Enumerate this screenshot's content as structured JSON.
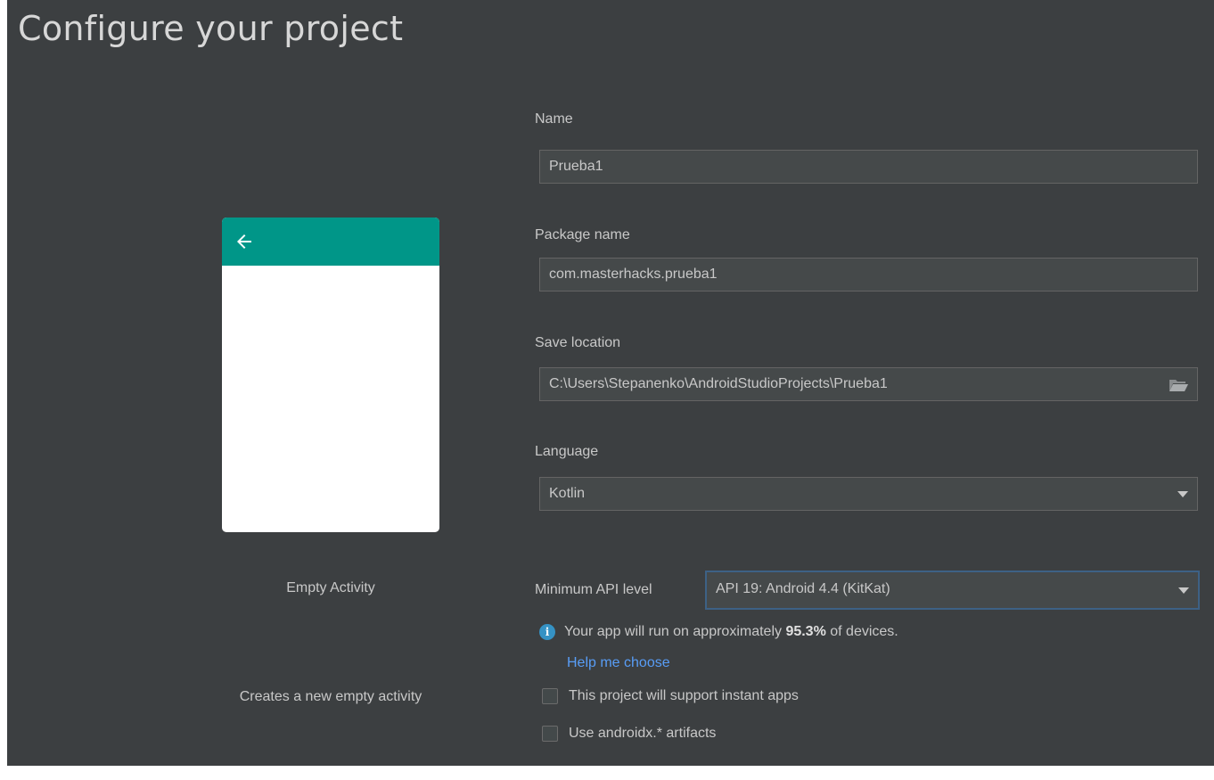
{
  "header": {
    "title": "Configure your project"
  },
  "template": {
    "name": "Empty Activity",
    "description": "Creates a new empty activity",
    "colors": {
      "app_bar": "#009688",
      "screen": "#ffffff"
    },
    "icon": "back-arrow-icon"
  },
  "form": {
    "name": {
      "label": "Name",
      "value": "Prueba1"
    },
    "package_name": {
      "label": "Package name",
      "value": "com.masterhacks.prueba1"
    },
    "save_location": {
      "label": "Save location",
      "value": "C:\\Users\\Stepanenko\\AndroidStudioProjects\\Prueba1",
      "icon": "folder-icon"
    },
    "language": {
      "label": "Language",
      "selected": "Kotlin"
    },
    "min_api": {
      "label": "Minimum API level",
      "selected": "API 19: Android 4.4 (KitKat)"
    }
  },
  "info": {
    "icon": "info-icon",
    "text_prefix": "Your app will run on approximately ",
    "percent": "95.3%",
    "text_suffix": " of devices.",
    "help_link": "Help me choose"
  },
  "options": {
    "instant_apps": {
      "label": "This project will support instant apps",
      "checked": false
    },
    "androidx": {
      "label": "Use androidx.* artifacts",
      "checked": false
    }
  },
  "colors": {
    "background": "#3c3f41",
    "field": "#45494a",
    "focus_border": "#3d6185",
    "link": "#589df6",
    "info": "#3592c4"
  }
}
